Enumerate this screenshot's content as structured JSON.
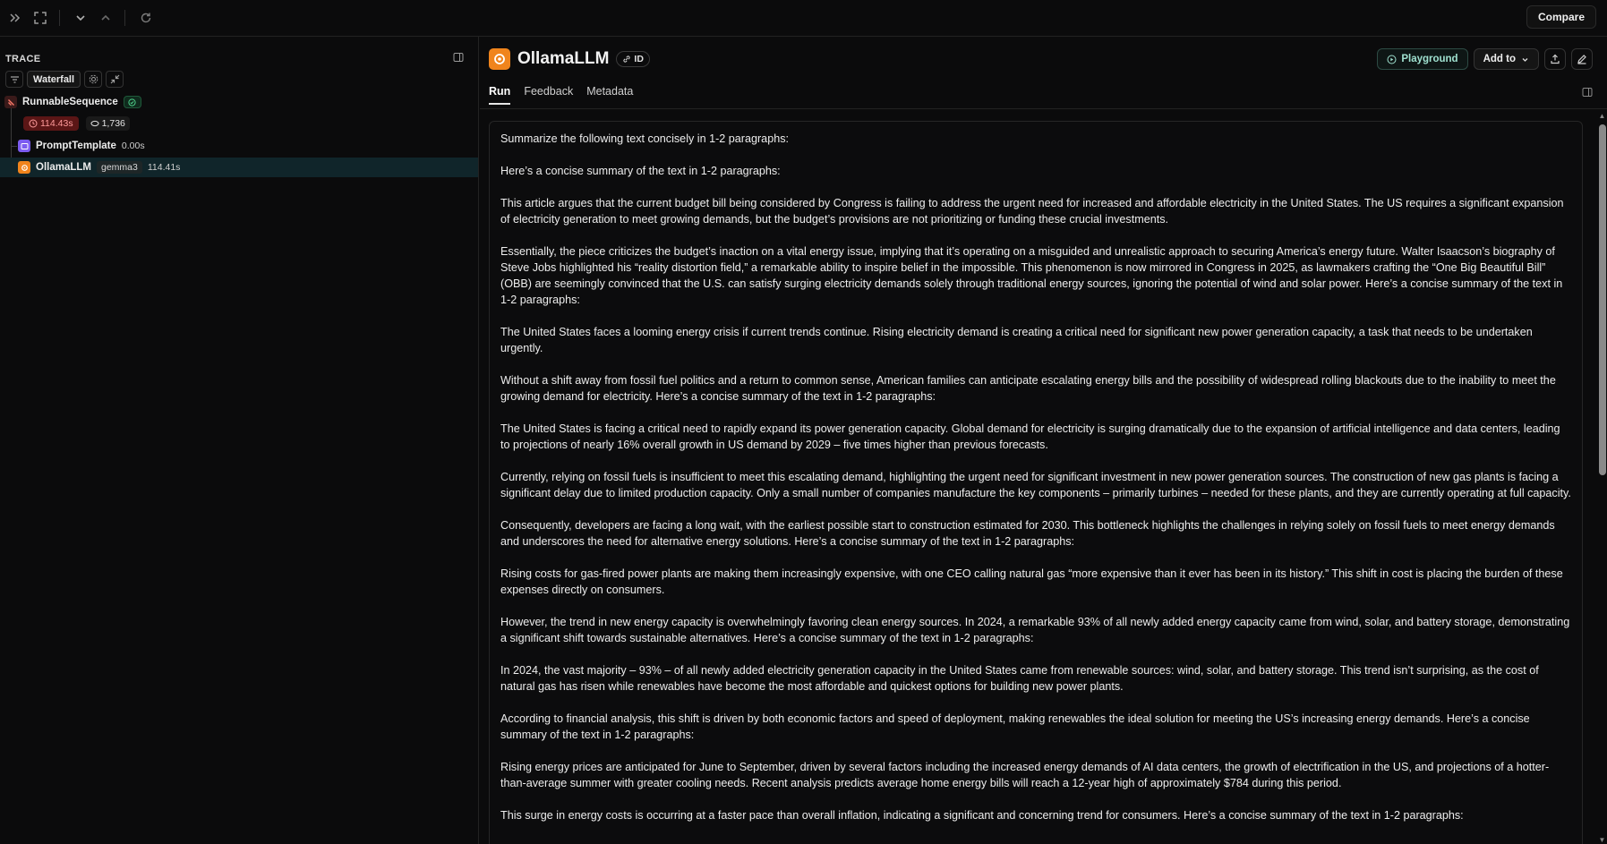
{
  "topbar": {
    "compare_label": "Compare",
    "icons": [
      "expand-panel-icon",
      "fullscreen-icon",
      "chevron-down-icon",
      "chevron-up-icon",
      "refresh-icon"
    ]
  },
  "trace": {
    "header": "TRACE",
    "view_label": "Waterfall",
    "nodes": [
      {
        "name": "RunnableSequence",
        "latency": "114.43s",
        "tokens": "1,736",
        "status": "success"
      },
      {
        "name": "PromptTemplate",
        "latency": "0.00s"
      },
      {
        "name": "OllamaLLM",
        "model": "gemma3",
        "latency": "114.41s"
      }
    ]
  },
  "run": {
    "title": "OllamaLLM",
    "id_label": "ID",
    "playground_label": "Playground",
    "add_to_label": "Add to",
    "tabs": [
      "Run",
      "Feedback",
      "Metadata"
    ],
    "active_tab": "Run"
  },
  "output": {
    "paragraphs": [
      "Summarize the following text concisely in 1-2 paragraphs:",
      "Here’s a concise summary of the text in 1-2 paragraphs:",
      "This article argues that the current budget bill being considered by Congress is failing to address the urgent need for increased and affordable electricity in the United States. The US requires a significant expansion of electricity generation to meet growing demands, but the budget’s provisions are not prioritizing or funding these crucial investments.",
      "Essentially, the piece criticizes the budget’s inaction on a vital energy issue, implying that it’s operating on a misguided and unrealistic approach to securing America’s energy future. Walter Isaacson’s biography of Steve Jobs highlighted his “reality distortion field,” a remarkable ability to inspire belief in the impossible. This phenomenon is now mirrored in Congress in 2025, as lawmakers crafting the “One Big Beautiful Bill” (OBB) are seemingly convinced that the U.S. can satisfy surging electricity demands solely through traditional energy sources, ignoring the potential of wind and solar power. Here’s a concise summary of the text in 1-2 paragraphs:",
      "The United States faces a looming energy crisis if current trends continue. Rising electricity demand is creating a critical need for significant new power generation capacity, a task that needs to be undertaken urgently.",
      "Without a shift away from fossil fuel politics and a return to common sense, American families can anticipate escalating energy bills and the possibility of widespread rolling blackouts due to the inability to meet the growing demand for electricity. Here’s a concise summary of the text in 1-2 paragraphs:",
      "The United States is facing a critical need to rapidly expand its power generation capacity. Global demand for electricity is surging dramatically due to the expansion of artificial intelligence and data centers, leading to projections of nearly 16% overall growth in US demand by 2029 – five times higher than previous forecasts.",
      "Currently, relying on fossil fuels is insufficient to meet this escalating demand, highlighting the urgent need for significant investment in new power generation sources. The construction of new gas plants is facing a significant delay due to limited production capacity. Only a small number of companies manufacture the key components – primarily turbines – needed for these plants, and they are currently operating at full capacity.",
      "Consequently, developers are facing a long wait, with the earliest possible start to construction estimated for 2030. This bottleneck highlights the challenges in relying solely on fossil fuels to meet energy demands and underscores the need for alternative energy solutions. Here’s a concise summary of the text in 1-2 paragraphs:",
      "Rising costs for gas-fired power plants are making them increasingly expensive, with one CEO calling natural gas “more expensive than it ever has been in its history.” This shift in cost is placing the burden of these expenses directly on consumers.",
      "However, the trend in new energy capacity is overwhelmingly favoring clean energy sources. In 2024, a remarkable 93% of all newly added energy capacity came from wind, solar, and battery storage, demonstrating a significant shift towards sustainable alternatives. Here’s a concise summary of the text in 1-2 paragraphs:",
      "In 2024, the vast majority – 93% – of all newly added electricity generation capacity in the United States came from renewable sources: wind, solar, and battery storage. This trend isn’t surprising, as the cost of natural gas has risen while renewables have become the most affordable and quickest options for building new power plants.",
      "According to financial analysis, this shift is driven by both economic factors and speed of deployment, making renewables the ideal solution for meeting the US’s increasing energy demands. Here’s a concise summary of the text in 1-2 paragraphs:",
      "Rising energy prices are anticipated for June to September, driven by several factors including the increased energy demands of AI data centers, the growth of electrification in the US, and projections of a hotter-than-average summer with greater cooling needs. Recent analysis predicts average home energy bills will reach a 12-year high of approximately $784 during this period.",
      "This surge in energy costs is occurring at a faster pace than overall inflation, indicating a significant and concerning trend for consumers. Here’s a concise summary of the text in 1-2 paragraphs:"
    ]
  },
  "colors": {
    "background": "#0b0b0c",
    "llm_orange": "#f0841c",
    "prompt_purple": "#7c5cf0",
    "error_red": "#5b1616",
    "success_green": "#1f5a3a",
    "selection": "#10252a"
  }
}
